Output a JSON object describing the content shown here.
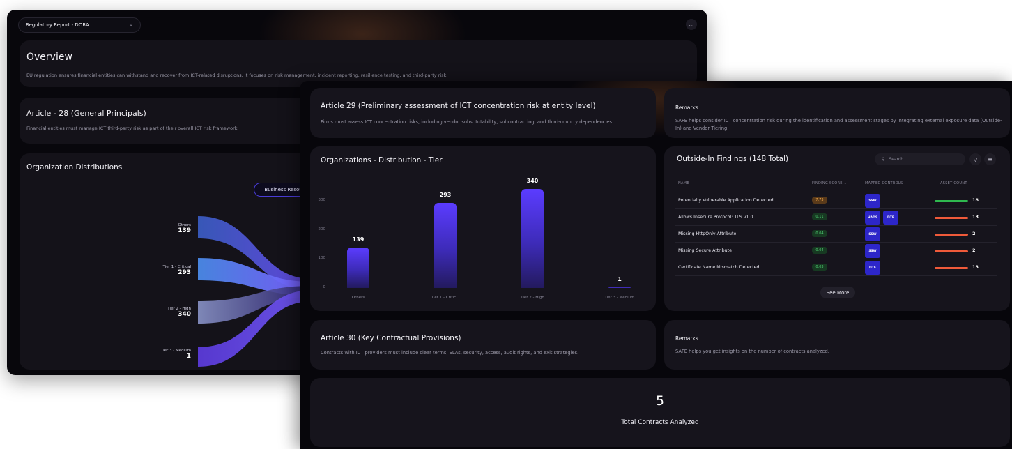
{
  "back_window": {
    "report_selector": "Regulatory Report - DORA",
    "more_label": "...",
    "overview": {
      "title": "Overview",
      "description": "EU regulation ensures financial entities can withstand and recover from ICT-related disruptions. It focuses on risk management, incident reporting, resilience testing, and third-party risk."
    },
    "article28": {
      "title": "Article - 28 (General Principals)",
      "description": "Financial entities must manage ICT third-party risk as part of their overall ICT risk framework."
    },
    "distributions": {
      "title": "Organization Distributions",
      "toggle_label": "Business Resource",
      "nodes": [
        {
          "name": "Others",
          "value": "139",
          "color": "#4f74d8"
        },
        {
          "name": "Tier 1 - Critical",
          "value": "293",
          "color": "#4c8bea"
        },
        {
          "name": "Tier 2 - High",
          "value": "340",
          "color": "#7b8ac8"
        },
        {
          "name": "Tier 3 - Medium",
          "value": "1",
          "color": "#5b3cd8"
        }
      ]
    }
  },
  "front_window": {
    "article29": {
      "title": "Article 29 (Preliminary assessment of ICT concentration risk at entity level)",
      "description": "Firms must assess ICT concentration risks, including vendor substitutability, subcontracting, and third-country dependencies."
    },
    "remarks1": {
      "title": "Remarks",
      "description": "SAFE helps consider ICT concentration risk during the identification and assessment stages by integrating external exposure data (Outside-In) and Vendor Tiering."
    },
    "tier_chart": {
      "title": "Organizations - Distribution - Tier",
      "y_ticks": [
        "300",
        "200",
        "100",
        "0"
      ]
    },
    "chart_data": {
      "type": "bar",
      "title": "Organizations - Distribution - Tier",
      "categories": [
        "Others",
        "Tier 1 - Critic...",
        "Tier 2 - High",
        "Tier 3 - Medium"
      ],
      "values": [
        139,
        293,
        340,
        1
      ],
      "ylim": [
        0,
        350
      ],
      "y_ticks": [
        0,
        100,
        200,
        300
      ],
      "bar_color": "#5b3cff",
      "grid": false
    },
    "findings": {
      "title": "Outside-In Findings (148 Total)",
      "search_placeholder": "Search",
      "filter_icon": "filter-icon",
      "settings_icon": "sliders-icon",
      "headers": {
        "name": "NAME",
        "score": "FINDING SCORE ⌄",
        "controls": "MAPPED CONTROLS",
        "assets": "ASSET COUNT"
      },
      "rows": [
        {
          "name": "Potentially Vulnerable Application Detected",
          "score": "7.73",
          "score_level": "medium",
          "controls": [
            "SSW"
          ],
          "asset_count": "18",
          "asset_color": "#2fb84f"
        },
        {
          "name": "Allows Insecure Protocol: TLS v1.0",
          "score": "0.11",
          "score_level": "low",
          "controls": [
            "HADS",
            "DTE"
          ],
          "asset_count": "13",
          "asset_color": "#ef5a3a"
        },
        {
          "name": "Missing HttpOnly Attribute",
          "score": "0.04",
          "score_level": "low",
          "controls": [
            "SSW"
          ],
          "asset_count": "2",
          "asset_color": "#ef5a3a"
        },
        {
          "name": "Missing Secure Attribute",
          "score": "0.04",
          "score_level": "low",
          "controls": [
            "SSW"
          ],
          "asset_count": "2",
          "asset_color": "#ef5a3a"
        },
        {
          "name": "Certificate Name Mismatch Detected",
          "score": "0.03",
          "score_level": "low",
          "controls": [
            "DTE"
          ],
          "asset_count": "13",
          "asset_color": "#ef5a3a"
        }
      ],
      "see_more_label": "See More"
    },
    "article30": {
      "title": "Article 30 (Key Contractual Provisions)",
      "description": "Contracts with ICT providers must include clear terms, SLAs, security, access, audit rights, and exit strategies."
    },
    "remarks2": {
      "title": "Remarks",
      "description": "SAFE helps you get insights on the number of contracts analyzed."
    },
    "contracts": {
      "value": "5",
      "label": "Total Contracts Analyzed"
    }
  }
}
